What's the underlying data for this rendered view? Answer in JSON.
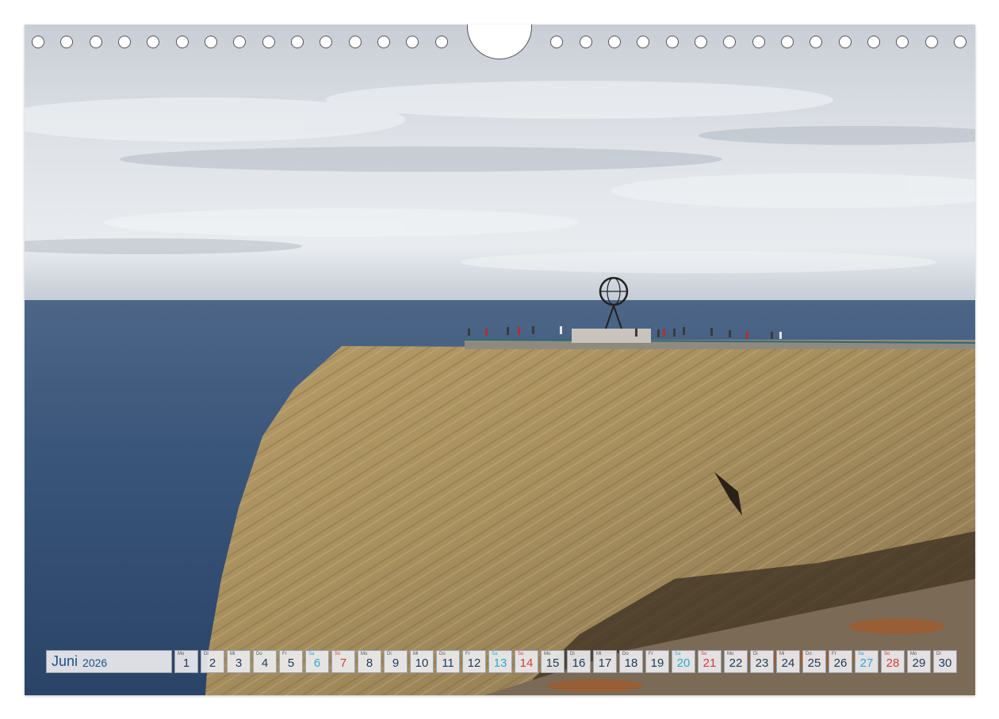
{
  "calendar": {
    "month": "Juni",
    "year": "2026",
    "days": [
      {
        "num": "1",
        "dow": "Mo",
        "kind": "weekday"
      },
      {
        "num": "2",
        "dow": "Di",
        "kind": "weekday"
      },
      {
        "num": "3",
        "dow": "Mi",
        "kind": "weekday"
      },
      {
        "num": "4",
        "dow": "Do",
        "kind": "weekday"
      },
      {
        "num": "5",
        "dow": "Fr",
        "kind": "weekday"
      },
      {
        "num": "6",
        "dow": "Sa",
        "kind": "sat"
      },
      {
        "num": "7",
        "dow": "So",
        "kind": "sun"
      },
      {
        "num": "8",
        "dow": "Mo",
        "kind": "weekday"
      },
      {
        "num": "9",
        "dow": "Di",
        "kind": "weekday"
      },
      {
        "num": "10",
        "dow": "Mi",
        "kind": "weekday"
      },
      {
        "num": "11",
        "dow": "Do",
        "kind": "weekday"
      },
      {
        "num": "12",
        "dow": "Fr",
        "kind": "weekday"
      },
      {
        "num": "13",
        "dow": "Sa",
        "kind": "sat"
      },
      {
        "num": "14",
        "dow": "So",
        "kind": "sun"
      },
      {
        "num": "15",
        "dow": "Mo",
        "kind": "weekday"
      },
      {
        "num": "16",
        "dow": "Di",
        "kind": "weekday"
      },
      {
        "num": "17",
        "dow": "Mi",
        "kind": "weekday"
      },
      {
        "num": "18",
        "dow": "Do",
        "kind": "weekday"
      },
      {
        "num": "19",
        "dow": "Fr",
        "kind": "weekday"
      },
      {
        "num": "20",
        "dow": "Sa",
        "kind": "sat"
      },
      {
        "num": "21",
        "dow": "So",
        "kind": "sun"
      },
      {
        "num": "22",
        "dow": "Mo",
        "kind": "weekday"
      },
      {
        "num": "23",
        "dow": "Di",
        "kind": "weekday"
      },
      {
        "num": "24",
        "dow": "Mi",
        "kind": "weekday"
      },
      {
        "num": "25",
        "dow": "Do",
        "kind": "weekday"
      },
      {
        "num": "26",
        "dow": "Fr",
        "kind": "weekday"
      },
      {
        "num": "27",
        "dow": "Sa",
        "kind": "sat"
      },
      {
        "num": "28",
        "dow": "So",
        "kind": "sun"
      },
      {
        "num": "29",
        "dow": "Mo",
        "kind": "weekday"
      },
      {
        "num": "30",
        "dow": "Di",
        "kind": "weekday"
      }
    ]
  },
  "colors": {
    "weekday": "#1e3a58",
    "saturday": "#2fa7d6",
    "sunday": "#d23a3a",
    "month_text": "#1b4f8a"
  }
}
